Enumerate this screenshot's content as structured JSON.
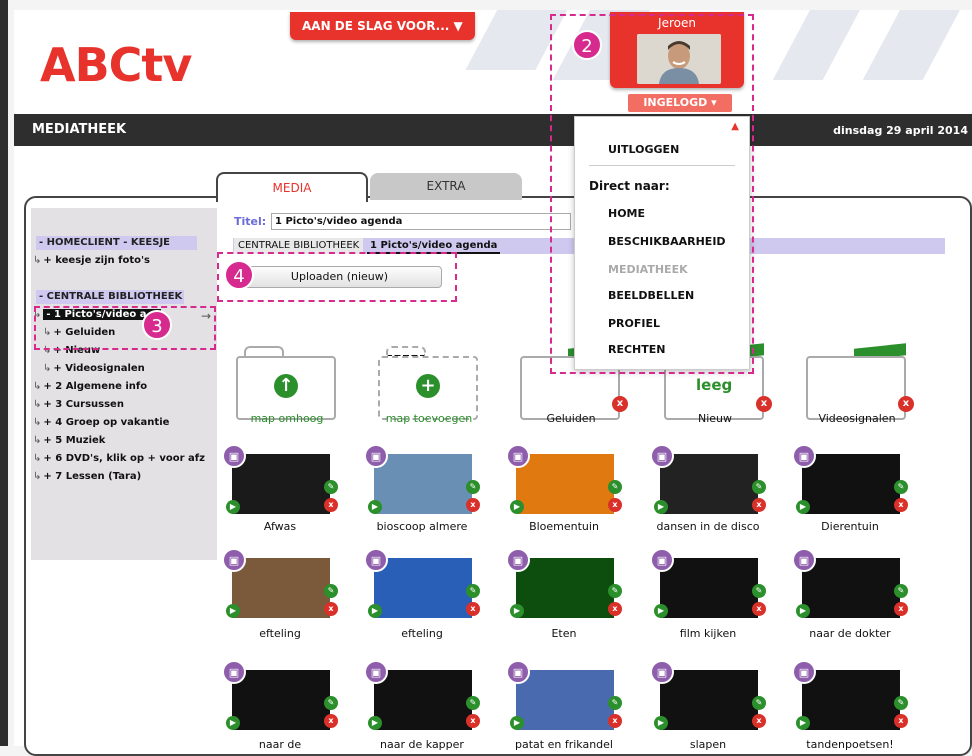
{
  "header": {
    "logo": "ABCtv",
    "cta": "AAN DE SLAG VOOR... ▼",
    "user_name": "Jeroen",
    "logged_in": "INGELOGD ▾"
  },
  "topbar": {
    "title": "MEDIATHEEK",
    "date": "dinsdag 29 april 2014"
  },
  "tabs": [
    {
      "label": "MEDIA"
    },
    {
      "label": "EXTRA"
    }
  ],
  "tree": {
    "group1": "- HOMECLIENT - KEESJE",
    "g1items": [
      "+ keesje zijn foto's"
    ],
    "group2": "- CENTRALE BIBLIOTHEEK",
    "selected": "- 1 Picto's/video a...",
    "subitems": [
      "+ Geluiden",
      "+ Nieuw",
      "+ Videosignalen"
    ],
    "items": [
      "+ 2 Algemene info",
      "+ 3 Cursussen",
      "+ 4 Groep op vakantie",
      "+ 5 Muziek",
      "+ 6 DVD's, klik op + voor afz",
      "+ 7 Lessen (Tara)"
    ]
  },
  "titel": {
    "label": "Titel:",
    "value": "1 Picto's/video agenda"
  },
  "crumbs": [
    "CENTRALE BIBLIOTHEEK",
    "1 Picto's/video agenda"
  ],
  "upload_label": "Uploaden (nieuw)",
  "menu": {
    "logout": "UITLOGGEN",
    "direct": "Direct naar:",
    "items": [
      "HOME",
      "BESCHIKBAARHEID",
      "MEDIATHEEK",
      "BEELDBELLEN",
      "PROFIEL",
      "RECHTEN"
    ],
    "disabled_item": "MEDIATHEEK"
  },
  "badges": [
    "2",
    "3",
    "4"
  ],
  "folders": [
    {
      "label": "map omhoog",
      "icon": "arrow-up-icon"
    },
    {
      "label": "map toevoegen",
      "icon": "plus-icon"
    },
    {
      "label": "Geluiden",
      "icon": "folder-icon"
    },
    {
      "label": "Nieuw",
      "icon": "folder-icon",
      "empty_text": "leeg"
    },
    {
      "label": "Videosignalen",
      "icon": "folder-icon"
    }
  ],
  "media": [
    "Afwas",
    "bioscoop almere",
    "Bloementuin",
    "dansen in de disco",
    "Dierentuin",
    "efteling",
    "efteling",
    "Eten",
    "film kijken",
    "naar de dokter",
    "naar de",
    "naar de kapper",
    "patat en frikandel",
    "slapen",
    "tandenpoetsen!"
  ],
  "thumb_colors": [
    "#1a1a1a",
    "#6a8fb5",
    "#e07a10",
    "#222222",
    "#111111",
    "#7a5a3a",
    "#2a5fb8",
    "#0d4d0d",
    "#111111",
    "#111111",
    "#111111",
    "#111111",
    "#4a6ab0",
    "#111111",
    "#111111"
  ],
  "colors": {
    "accent": "#e8322c",
    "highlight": "#d72a8e",
    "green": "#2b8f2b",
    "purple": "#8e5dab"
  }
}
